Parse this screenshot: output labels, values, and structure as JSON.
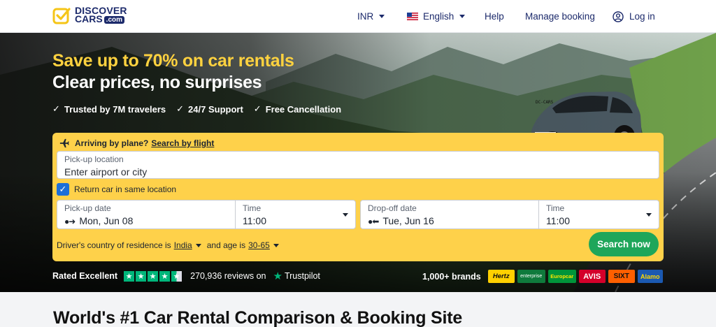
{
  "header": {
    "logo_line1": "DISCOVER",
    "logo_line2": "CARS",
    "logo_com": ".com",
    "currency": "INR",
    "language": "English",
    "help": "Help",
    "manage_booking": "Manage booking",
    "login": "Log in"
  },
  "hero": {
    "headline": "Save up to 70% on car rentals",
    "subheadline": "Clear prices, no surprises",
    "perks": [
      "Trusted by 7M travelers",
      "24/7 Support",
      "Free Cancellation"
    ],
    "license_plate": "DC-CARS"
  },
  "search": {
    "plane_prompt": "Arriving by plane?",
    "plane_link": "Search by flight",
    "pickup_location_label": "Pick-up location",
    "pickup_location_placeholder": "Enter airport or city",
    "return_same": "Return car in same location",
    "return_same_checked": true,
    "pickup_date_label": "Pick-up date",
    "pickup_date_value": "Mon, Jun 08",
    "pickup_time_label": "Time",
    "pickup_time_value": "11:00",
    "dropoff_date_label": "Drop-off date",
    "dropoff_date_value": "Tue, Jun 16",
    "dropoff_time_label": "Time",
    "dropoff_time_value": "11:00",
    "residence_prefix": "Driver's country of residence is",
    "residence_country": "India",
    "age_prefix": "and age is",
    "age_value": "30-65",
    "search_button": "Search now"
  },
  "rating": {
    "label": "Rated Excellent",
    "reviews": "270,936 reviews on",
    "provider": "Trustpilot",
    "brands_label": "1,000+ brands",
    "brands": [
      "Hertz",
      "enterprise",
      "Europcar",
      "AVIS",
      "SIXT",
      "Alamo"
    ]
  },
  "colors": {
    "accent_yellow": "#fed14a",
    "headline_yellow": "#ffd23f",
    "search_green": "#1ea65a",
    "brand_navy": "#1c2a6b",
    "trustpilot_green": "#00b67a"
  },
  "bottom": {
    "title": "World's #1 Car Rental Comparison & Booking Site"
  }
}
